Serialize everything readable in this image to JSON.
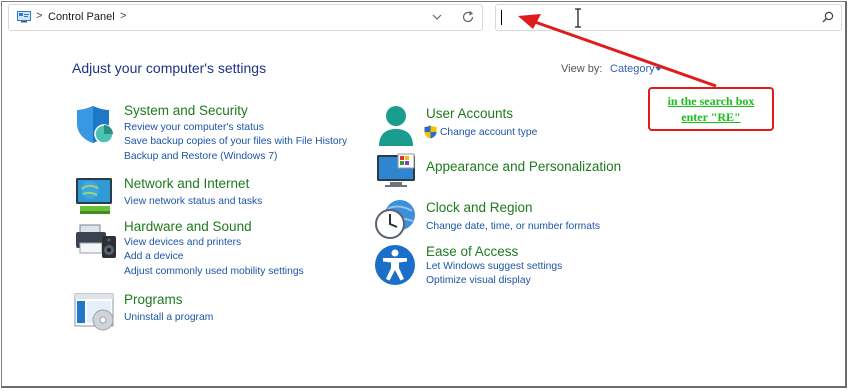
{
  "address_bar": {
    "breadcrumb": "Control Panel",
    "separator": ">"
  },
  "search": {
    "value": "",
    "placeholder": ""
  },
  "main": {
    "heading": "Adjust your computer's settings",
    "view_by_label": "View by:",
    "view_by_value": "Category"
  },
  "categories_left": [
    {
      "title": "System and Security",
      "icon": "shield-icon",
      "links": [
        "Review your computer's status",
        "Save backup copies of your files with File History",
        "Backup and Restore (Windows 7)"
      ]
    },
    {
      "title": "Network and Internet",
      "icon": "network-globe-icon",
      "links": [
        "View network status and tasks"
      ]
    },
    {
      "title": "Hardware and Sound",
      "icon": "printer-speaker-icon",
      "links": [
        "View devices and printers",
        "Add a device",
        "Adjust commonly used mobility settings"
      ]
    },
    {
      "title": "Programs",
      "icon": "programs-icon",
      "links": [
        "Uninstall a program"
      ]
    }
  ],
  "categories_right": [
    {
      "title": "User Accounts",
      "icon": "user-icon",
      "links": [
        "Change account type"
      ]
    },
    {
      "title": "Appearance and Personalization",
      "icon": "monitor-palette-icon",
      "links": []
    },
    {
      "title": "Clock and Region",
      "icon": "clock-globe-icon",
      "links": [
        "Change date, time, or number formats"
      ]
    },
    {
      "title": "Ease of Access",
      "icon": "accessibility-icon",
      "links": [
        "Let Windows suggest settings",
        "Optimize visual display"
      ]
    }
  ],
  "annotation": {
    "line1": "in the search box",
    "line2": "enter \"RE\"",
    "color": "#18c018",
    "border_color": "#e01b1b"
  },
  "colors": {
    "heading": "#1e3287",
    "category_title": "#1e7a1e",
    "link": "#1c55a8"
  }
}
